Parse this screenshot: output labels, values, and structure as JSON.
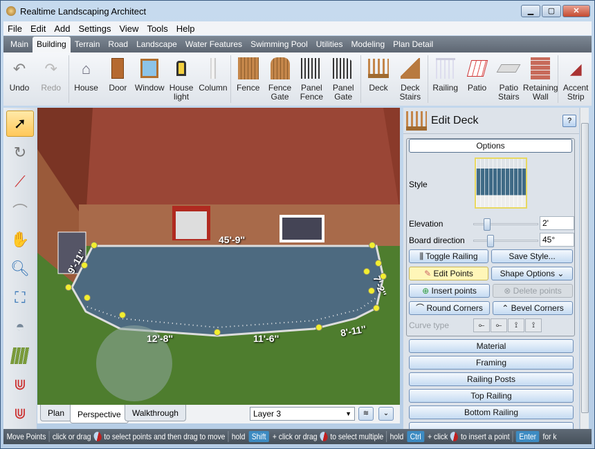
{
  "window": {
    "title": "Realtime Landscaping Architect",
    "controls": [
      "minimize",
      "maximize",
      "close"
    ]
  },
  "menu": [
    "File",
    "Edit",
    "Add",
    "Settings",
    "View",
    "Tools",
    "Help"
  ],
  "tabs": [
    {
      "label": "Main"
    },
    {
      "label": "Building",
      "active": true
    },
    {
      "label": "Terrain"
    },
    {
      "label": "Road"
    },
    {
      "label": "Landscape"
    },
    {
      "label": "Water Features"
    },
    {
      "label": "Swimming Pool"
    },
    {
      "label": "Utilities"
    },
    {
      "label": "Modeling"
    },
    {
      "label": "Plan Detail"
    }
  ],
  "ribbon": [
    {
      "label": "Undo",
      "icon": "undo-icon"
    },
    {
      "label": "Redo",
      "icon": "redo-icon",
      "disabled": true
    },
    {
      "label": "House",
      "icon": "house-icon"
    },
    {
      "label": "Door",
      "icon": "door-icon"
    },
    {
      "label": "Window",
      "icon": "window-icon"
    },
    {
      "label": "House light",
      "icon": "lamp-icon"
    },
    {
      "label": "Column",
      "icon": "column-icon"
    },
    {
      "label": "Fence",
      "icon": "fence-icon"
    },
    {
      "label": "Fence Gate",
      "icon": "fence-gate-icon"
    },
    {
      "label": "Panel Fence",
      "icon": "panel-fence-icon"
    },
    {
      "label": "Panel Gate",
      "icon": "panel-gate-icon"
    },
    {
      "label": "Deck",
      "icon": "deck-icon"
    },
    {
      "label": "Deck Stairs",
      "icon": "deck-stairs-icon"
    },
    {
      "label": "Railing",
      "icon": "railing-icon"
    },
    {
      "label": "Patio",
      "icon": "patio-icon"
    },
    {
      "label": "Patio Stairs",
      "icon": "patio-stairs-icon"
    },
    {
      "label": "Retaining Wall",
      "icon": "retaining-wall-icon"
    },
    {
      "label": "Accent Strip",
      "icon": "accent-strip-icon"
    }
  ],
  "tools": [
    "select-arrow-icon",
    "rotate-icon",
    "edit-line-icon",
    "curve-icon",
    "pan-hand-icon",
    "zoom-icon",
    "zoom-window-icon",
    "orbit-icon",
    "grid-icon",
    "magnet-icon",
    "magnet-alt-icon"
  ],
  "viewport": {
    "dimensions": [
      "45'-9''",
      "9'-11''",
      "7'-2''",
      "12'-8''",
      "11'-6''",
      "8'-11''"
    ]
  },
  "view_tabs": [
    {
      "label": "Plan"
    },
    {
      "label": "Perspective",
      "active": true
    },
    {
      "label": "Walkthrough"
    }
  ],
  "layer": {
    "value": "Layer 3"
  },
  "panel": {
    "title": "Edit Deck",
    "help": "?",
    "options_label": "Options",
    "style_label": "Style",
    "elevation": {
      "label": "Elevation",
      "value": "2'",
      "slider": 0.15
    },
    "board_direction": {
      "label": "Board direction",
      "value": "45°",
      "slider": 0.2
    },
    "buttons": {
      "toggle_railing": "Toggle Railing",
      "save_style": "Save Style...",
      "edit_points": "Edit Points",
      "shape_options": "Shape Options",
      "insert_points": "Insert points",
      "delete_points": "Delete points",
      "round_corners": "Round Corners",
      "bevel_corners": "Bevel Corners"
    },
    "curve_type_label": "Curve type",
    "sections": [
      "Material",
      "Framing",
      "Railing Posts",
      "Top Railing",
      "Bottom Railing"
    ]
  },
  "status": {
    "mode": "Move Points",
    "t1": "click or drag",
    "t2": "to select points and then drag to move",
    "hold1": "hold",
    "key1": "Shift",
    "t3": "+ click or drag",
    "t4": "to select multiple",
    "hold2": "hold",
    "key2": "Ctrl",
    "t5": "+ click",
    "t6": "to insert a point",
    "key3": "Enter",
    "t7": "for k"
  }
}
